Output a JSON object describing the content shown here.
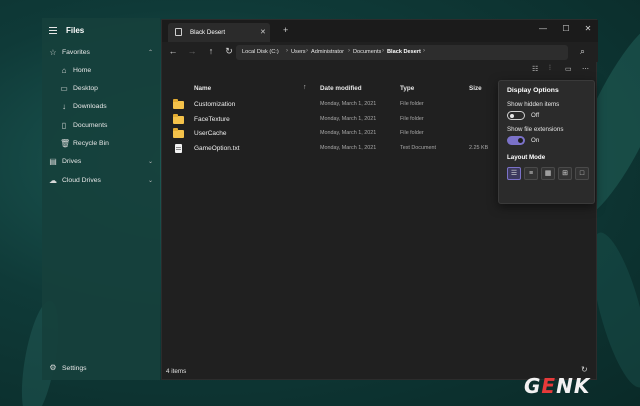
{
  "app": {
    "title": "Files"
  },
  "sidebar": {
    "items": [
      {
        "label": "Favorites",
        "icon": "star-icon",
        "glyph": "☆",
        "chevron": "⌃"
      },
      {
        "label": "Home",
        "icon": "home-icon",
        "glyph": "⌂"
      },
      {
        "label": "Desktop",
        "icon": "desktop-icon",
        "glyph": "▭"
      },
      {
        "label": "Downloads",
        "icon": "download-icon",
        "glyph": "↓"
      },
      {
        "label": "Documents",
        "icon": "document-icon",
        "glyph": "▯"
      },
      {
        "label": "Recycle Bin",
        "icon": "trash-icon",
        "glyph": "🗑"
      },
      {
        "label": "Drives",
        "icon": "drive-icon",
        "glyph": "▤",
        "chevron": "⌄"
      },
      {
        "label": "Cloud Drives",
        "icon": "cloud-icon",
        "glyph": "☁",
        "chevron": "⌄"
      }
    ],
    "settings_label": "Settings"
  },
  "tab": {
    "label": "Black Desert",
    "close": "✕",
    "new_tab": "+"
  },
  "window_controls": {
    "minimize": "—",
    "maximize": "☐",
    "close": "✕"
  },
  "nav": {
    "back": "←",
    "forward": "→",
    "up": "↑",
    "refresh": "↻",
    "search": "⌕"
  },
  "breadcrumb": [
    "Local Disk (C:)",
    "Users",
    "Administrator",
    "Documents",
    "Black Desert"
  ],
  "columns": {
    "name": "Name",
    "date": "Date modified",
    "type": "Type",
    "size": "Size"
  },
  "files": [
    {
      "name": "Customization",
      "date": "Monday, March 1, 2021",
      "type": "File folder",
      "size": "",
      "kind": "folder"
    },
    {
      "name": "FaceTexture",
      "date": "Monday, March 1, 2021",
      "type": "File folder",
      "size": "",
      "kind": "folder"
    },
    {
      "name": "UserCache",
      "date": "Monday, March 1, 2021",
      "type": "File folder",
      "size": "",
      "kind": "folder"
    },
    {
      "name": "GameOption.txt",
      "date": "Monday, March 1, 2021",
      "type": "Text Document",
      "size": "2.25 KB",
      "kind": "file"
    }
  ],
  "status": {
    "item_count": "4 items"
  },
  "display_options": {
    "title": "Display Options",
    "hidden_items_label": "Show hidden items",
    "hidden_items_state": "Off",
    "extensions_label": "Show file extensions",
    "extensions_state": "On",
    "layout_mode_label": "Layout Mode",
    "accent": "#7b72c9"
  },
  "watermark": {
    "text_g": "G",
    "text_e": "E",
    "text_nk": "NK"
  }
}
